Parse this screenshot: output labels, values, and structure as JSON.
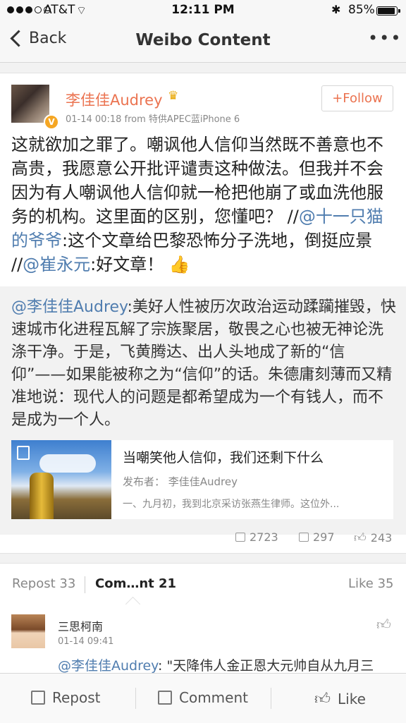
{
  "status_bar": {
    "carrier": "AT&T",
    "time": "12:11 PM",
    "battery": "85%",
    "battery_level": 0.85
  },
  "nav": {
    "back_label": "Back",
    "title": "Weibo Content",
    "more_label": "•••"
  },
  "post": {
    "author": "李佳佳Audrey",
    "verified_badge": "V",
    "meta": "01-14 00:18  from 特供APEC蓝iPhone 6",
    "follow_label": "+Follow",
    "text_parts": [
      "这就欲加之罪了。嘲讽他人信仰当然既不善意也不高贵，我愿意公开批评谴责这种做法。但我并不会因为有人嘲讽他人信仰就一枪把他崩了或血洗他服务的机构。这里面的区别，您懂吧？ //",
      "@十一只猫的爷爷",
      ":这个文章给巴黎恐怖分子洗地，倒挺应景 //",
      "@崔永元",
      ":好文章！"
    ],
    "thumb_emoji": "👍",
    "repost": {
      "mention": "@李佳佳Audrey",
      "text": ":美好人性被历次政治运动蹂躏摧毁，快速城市化进程瓦解了宗族聚居，敬畏之心也被无神论洗涤干净。于是，飞黄腾达、出人头地成了新的“信仰”——如果能被称之为“信仰”的话。朱德庸刻薄而又精准地说：现代人的问题是都希望成为一个有钱人，而不是成为一个人。",
      "card": {
        "title": "当嘲笑他人信仰，我们还剩下什么",
        "publisher": "发布者：  李佳佳Audrey",
        "excerpt": "一、九月初，我到北京采访张燕生律师。这位外..."
      },
      "stats": {
        "reposts": "2723",
        "comments": "297",
        "likes": "243"
      }
    }
  },
  "tabs": {
    "repost": "Repost 33",
    "comment": "Com…nt 21",
    "like": "Like 35"
  },
  "comment": {
    "name": "三思柯南",
    "time": "01-14 09:41",
    "mention": "@李佳佳Audrey",
    "text": ": \"天降伟人金正恩大元帅自从九月三"
  },
  "toolbar": {
    "repost": "Repost",
    "comment": "Comment",
    "like": "Like"
  }
}
